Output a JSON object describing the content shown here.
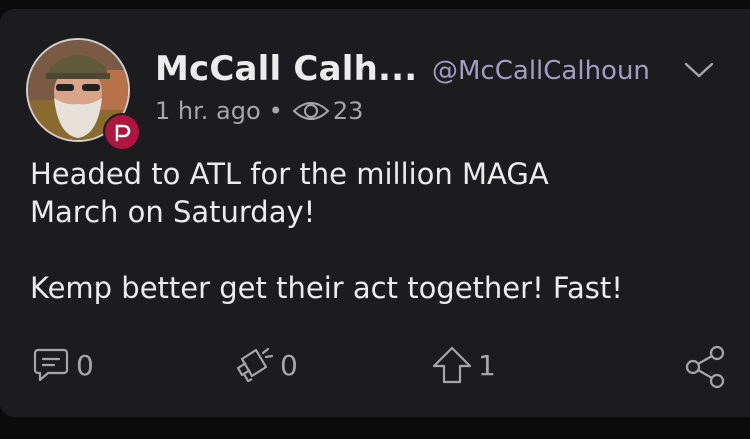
{
  "post": {
    "display_name": "McCall Calh...",
    "handle": "@McCallCalhoun",
    "time": "1 hr. ago",
    "separator": "•",
    "views": "23",
    "body_line1": "Headed to ATL for the million MAGA",
    "body_line2": "March on Saturday!",
    "body_line3": "Kemp better get their act together! Fast!"
  },
  "actions": {
    "comments": "0",
    "echoes": "0",
    "upvotes": "1"
  },
  "colors": {
    "card_bg": "#1c1c1e",
    "handle": "#a39cc4",
    "badge": "#b0153f",
    "muted": "#a6a6aa"
  },
  "icons": [
    "eye-icon",
    "chevron-down-icon",
    "comment-icon",
    "echo-icon",
    "upvote-icon",
    "share-icon",
    "parler-badge-icon"
  ]
}
